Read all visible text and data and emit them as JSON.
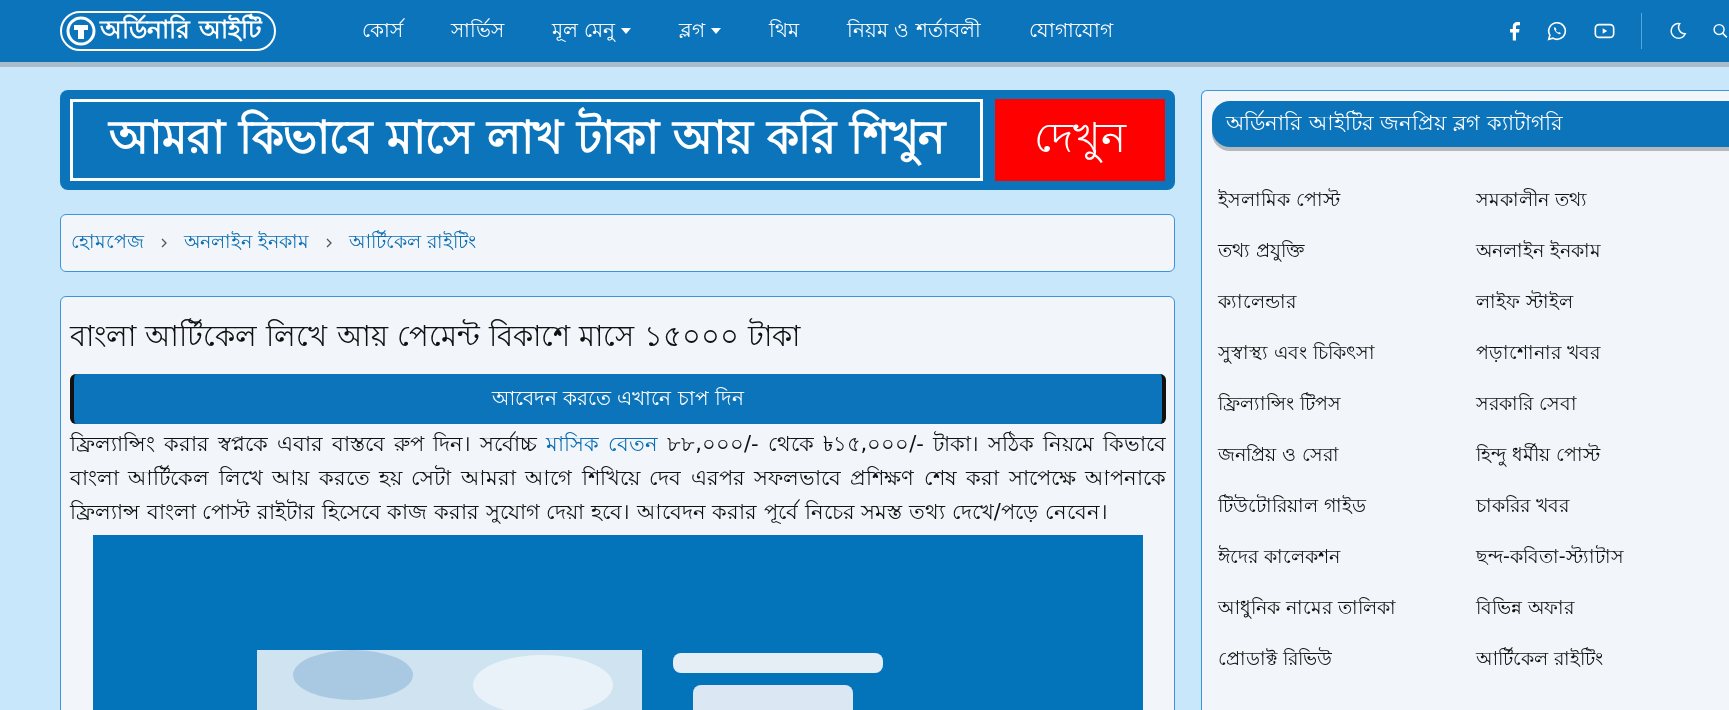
{
  "header": {
    "logo": "অর্ডিনারি আইটি",
    "nav": [
      {
        "label": "কোর্স",
        "dropdown": false
      },
      {
        "label": "সার্ভিস",
        "dropdown": false
      },
      {
        "label": "মূল মেনু",
        "dropdown": true
      },
      {
        "label": "ব্লগ",
        "dropdown": true
      },
      {
        "label": "থিম",
        "dropdown": false
      },
      {
        "label": "নিয়ম ও শর্তাবলী",
        "dropdown": false
      },
      {
        "label": "যোগাযোগ",
        "dropdown": false
      }
    ]
  },
  "banner": {
    "text": "আমরা কিভাবে মাসে লাখ টাকা আয় করি শিখুন",
    "button": "দেখুন"
  },
  "breadcrumb": [
    "হোমপেজ",
    "অনলাইন ইনকাম",
    "আর্টিকেল রাইটিং"
  ],
  "article": {
    "title": "বাংলা আর্টিকেল লিখে আয় পেমেন্ট বিকাশে মাসে ১৫০০০ টাকা",
    "apply_button": "আবেদন করতে এখানে চাপ দিন",
    "paragraph": {
      "before": "ফ্রিল্যান্সিং করার স্বপ্নকে এবার বাস্তবে রুপ দিন। সর্বোচ্চ ",
      "link": "মাসিক বেতন",
      "after": " ৮৮,০০০/- থেকে ৳১৫,০০০/- টাকা। সঠিক নিয়মে কিভাবে বাংলা আর্টিকেল লিখে আয় করতে হয় সেটা আমরা আগে শিখিয়ে দেব এরপর সফলভাবে প্রশিক্ষণ শেষ করা সাপেক্ষে আপনাকে ফ্রিল্যান্স বাংলা পোস্ট রাইটার হিসেবে কাজ করার সুযোগ দেয়া হবে। আবেদন করার পূর্বে নিচের সমস্ত তথ্য দেখে/পড়ে নেবেন।"
    }
  },
  "sidebar": {
    "title": "অর্ডিনারি আইটির জনপ্রিয় ব্লগ ক্যাটাগরি",
    "categories": [
      "ইসলামিক পোস্ট",
      "সমকালীন তথ্য",
      "তথ্য প্রযুক্তি",
      "অনলাইন ইনকাম",
      "ক্যালেন্ডার",
      "লাইফ স্টাইল",
      "সুস্বাস্থ্য এবং চিকিৎসা",
      "পড়াশোনার খবর",
      "ফ্রিল্যান্সিং টিপস",
      "সরকারি সেবা",
      "জনপ্রিয় ও সেরা",
      "হিন্দু ধর্মীয় পোস্ট",
      "টিউটোরিয়াল গাইড",
      "চাকরির খবর",
      "ঈদের কালেকশন",
      "ছন্দ-কবিতা-স্ট্যাটাস",
      "আধুনিক নামের তালিকা",
      "বিভিন্ন অফার",
      "প্রোডাক্ট রিভিউ",
      "আর্টিকেল রাইটিং"
    ]
  }
}
